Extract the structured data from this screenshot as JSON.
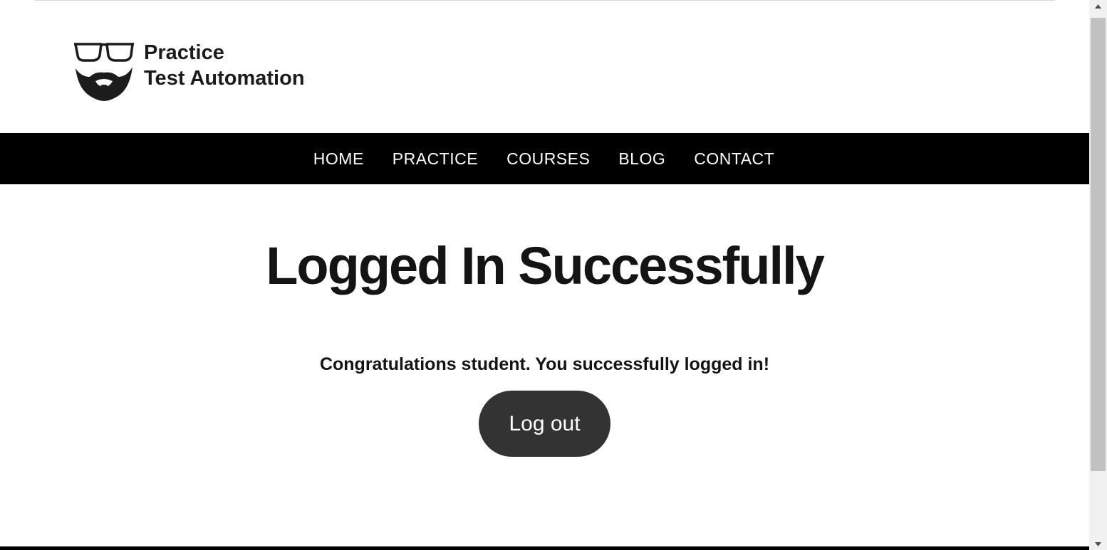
{
  "site": {
    "logo": {
      "line1": "Practice",
      "line2": "Test Automation",
      "icon": "glasses-beard-logo-icon"
    }
  },
  "nav": {
    "items": [
      {
        "label": "HOME"
      },
      {
        "label": "PRACTICE"
      },
      {
        "label": "COURSES"
      },
      {
        "label": "BLOG"
      },
      {
        "label": "CONTACT"
      }
    ]
  },
  "main": {
    "title": "Logged In Successfully",
    "message": "Congratulations student. You successfully logged in!",
    "logout_label": "Log out"
  },
  "colors": {
    "nav_background": "#000000",
    "button_background": "#333333",
    "text": "#141414"
  }
}
